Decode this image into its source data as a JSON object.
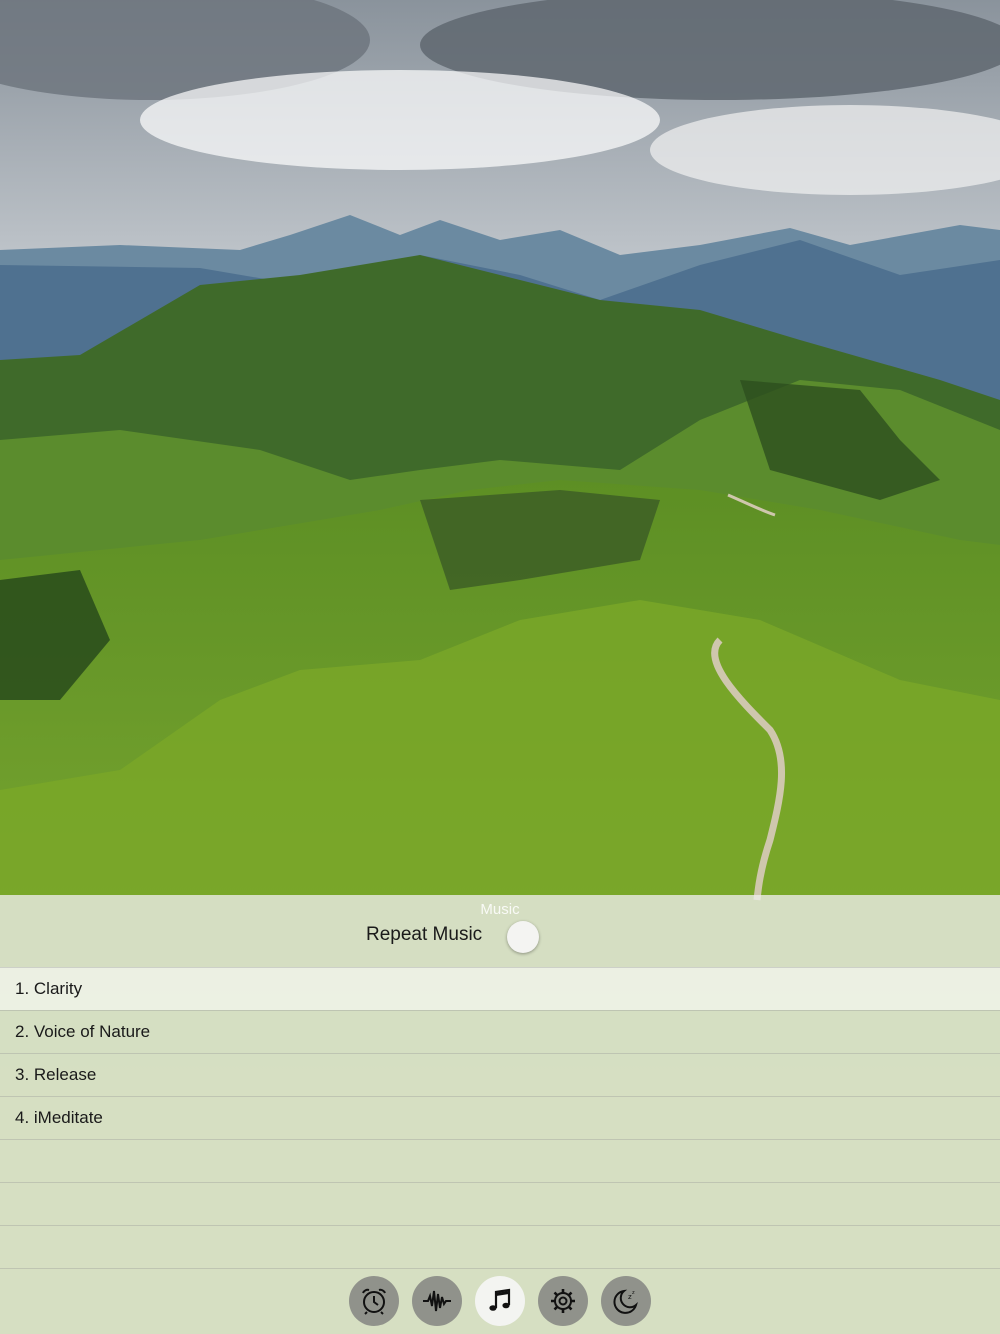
{
  "background": {
    "description_icon": "mountain-landscape-photo",
    "colors": {
      "sky": "#d9dde2",
      "cloud_dark": "#5f6770",
      "mountains_far": "#5e7e96",
      "hills_mid": "#46742c",
      "grass_near": "#7aa82a"
    }
  },
  "panel": {
    "title": "Music",
    "repeat_label": "Repeat Music",
    "repeat_on": false
  },
  "tracks": [
    {
      "label": "1. Clarity",
      "selected": true
    },
    {
      "label": "2. Voice of Nature",
      "selected": false
    },
    {
      "label": "3. Release",
      "selected": false
    },
    {
      "label": "4. iMeditate",
      "selected": false
    }
  ],
  "tabs": [
    {
      "icon": "alarm-clock-icon",
      "active": false
    },
    {
      "icon": "sound-wave-icon",
      "active": false
    },
    {
      "icon": "music-note-icon",
      "active": true
    },
    {
      "icon": "gear-icon",
      "active": false
    },
    {
      "icon": "moon-sleep-icon",
      "active": false
    }
  ]
}
